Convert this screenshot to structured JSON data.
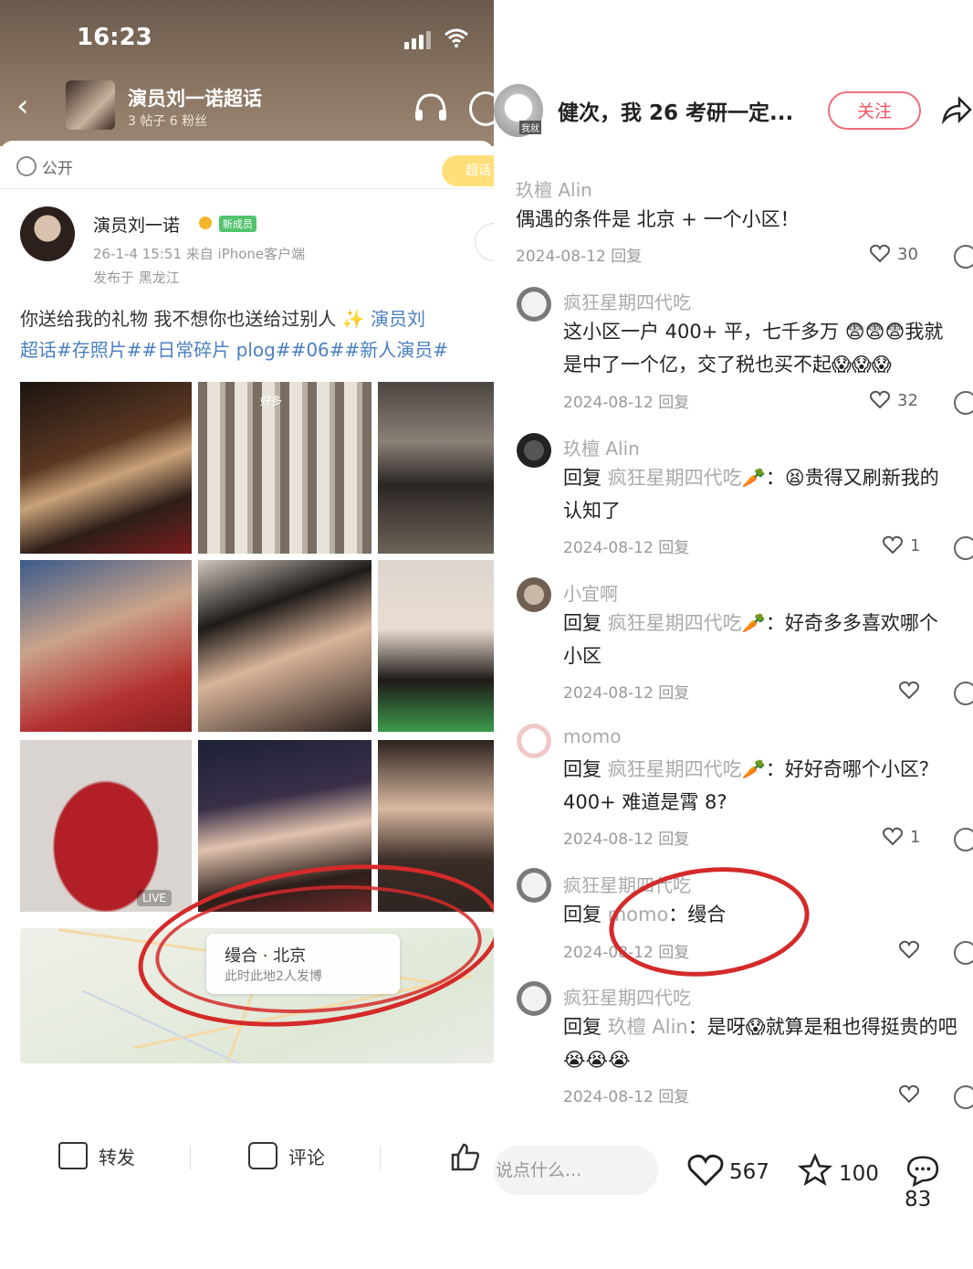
{
  "left": {
    "status": {
      "time": "16:23"
    },
    "header": {
      "title": "演员刘一诺超话",
      "sub": "3 帖子 6 粉丝"
    },
    "visibility": "公开",
    "badge": "超话",
    "post": {
      "author": "演员刘一诺",
      "author_badge": "新成员",
      "time": "26-1-4 15:51  来自 iPhone客户端",
      "location": "发布于 黑龙江",
      "text_line1": "你送给我的礼物 我不想你也送给过别人",
      "tag_line1": "演员刘",
      "text_line2": "超话#存照片##日常碎片 plog##06##新人演员#",
      "photo_caption_b": "好多",
      "live_label": "LIVE"
    },
    "map": {
      "title": "缦合 · 北京",
      "sub": "此时此地2人发博"
    },
    "actions": {
      "repost": "转发",
      "comment": "评论"
    }
  },
  "right": {
    "header": {
      "title": "健次，我 26 考研一定...",
      "follow": "关注",
      "avatar_label": "我就"
    },
    "comments": [
      {
        "name": "玖檀 Alin",
        "text": "偶遇的条件是 北京 + 一个小区！",
        "date": "2024-08-12 回复",
        "likes": "30"
      },
      {
        "name": "疯狂星期四代吃",
        "text": "这小区一户 400+ 平，七千多万",
        "text2": "我就",
        "text3": "是中了一个亿，交了税也买不起",
        "date": "2024-08-12 回复",
        "likes": "32"
      },
      {
        "name": "玖檀 Alin",
        "reply_prefix": "回复 ",
        "reply_to": "疯狂星期四代吃",
        "text": "：",
        "text2": "贵得又刷新我的",
        "text3": "认知了",
        "date": "2024-08-12 回复",
        "likes": "1"
      },
      {
        "name": "小宜啊",
        "reply_prefix": "回复 ",
        "reply_to": "疯狂星期四代吃",
        "text": "：好奇多多喜欢哪个",
        "text3": "小区",
        "date": "2024-08-12 回复",
        "likes": ""
      },
      {
        "name": "momo",
        "reply_prefix": "回复 ",
        "reply_to": "疯狂星期四代吃",
        "text": "：好好奇哪个小区？",
        "text3": "400+ 难道是霄 8?",
        "date": "2024-08-12 回复",
        "likes": "1"
      },
      {
        "name": "疯狂星期四代吃",
        "reply_prefix": "回复 ",
        "reply_to": "momo",
        "text": "：缦合",
        "date": "2024-08-12 回复",
        "likes": ""
      },
      {
        "name": "疯狂星期四代吃",
        "reply_prefix": "回复 ",
        "reply_to": "玖檀 Alin",
        "text": "：是呀",
        "text2": "就算是租也得挺贵的吧",
        "date": "2024-08-12 回复",
        "likes": ""
      }
    ],
    "bottom": {
      "placeholder": "说点什么...",
      "likes": "567",
      "stars": "100",
      "comments": "83"
    }
  },
  "colors": {
    "accent_red": "#d42a2a",
    "follow_pink": "#ee5565",
    "tag_blue": "#4a7fc0"
  }
}
